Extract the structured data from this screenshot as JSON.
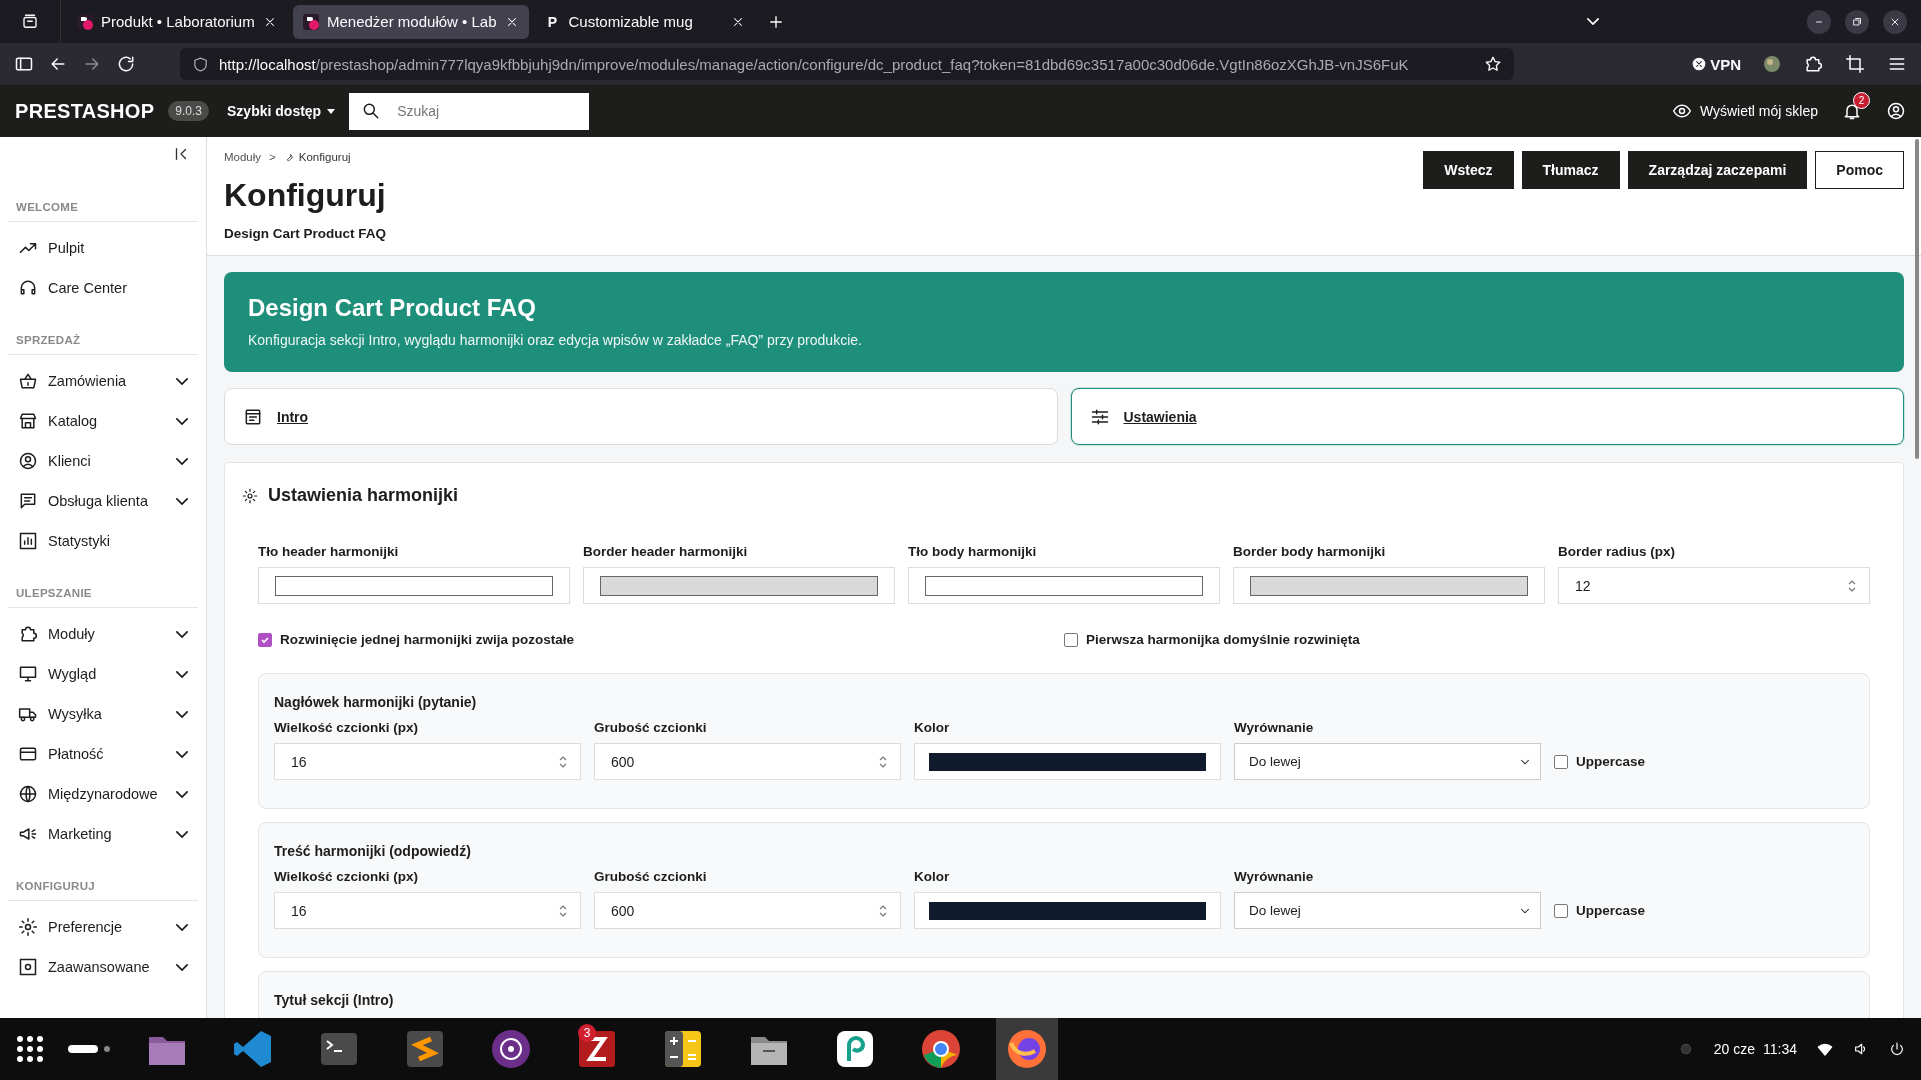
{
  "browser": {
    "tabs": [
      {
        "title": "Produkt • Laboratorium",
        "kind": "ps",
        "selected": false
      },
      {
        "title": "Menedżer modułów • Lab",
        "kind": "ps",
        "selected": true
      },
      {
        "title": "Customizable mug",
        "kind": "letter",
        "letter": "P",
        "selected": false
      }
    ],
    "url_host": "http://localhost",
    "url_path": "/prestashop/admin777lqya9kfbbjuhj9dn/improve/modules/manage/action/configure/dc_product_faq?token=81dbd69c3517a00c30d06de.VgtIn86ozXGhJB-vnJS6FuK",
    "vpn": "VPN"
  },
  "topbar": {
    "brand": "PRESTASHOP",
    "version": "9.0.3",
    "quick_access": "Szybki dostęp",
    "search_placeholder": "Szukaj",
    "view_shop": "Wyświetl mój sklep",
    "notifications": "2"
  },
  "sidebar": {
    "sections": [
      {
        "title": "WELCOME",
        "items": [
          {
            "label": "Pulpit",
            "expandable": false
          },
          {
            "label": "Care Center",
            "expandable": false
          }
        ]
      },
      {
        "title": "SPRZEDAŻ",
        "items": [
          {
            "label": "Zamówienia",
            "expandable": true
          },
          {
            "label": "Katalog",
            "expandable": true
          },
          {
            "label": "Klienci",
            "expandable": true
          },
          {
            "label": "Obsługa klienta",
            "expandable": true
          },
          {
            "label": "Statystyki",
            "expandable": false
          }
        ]
      },
      {
        "title": "ULEPSZANIE",
        "items": [
          {
            "label": "Moduły",
            "expandable": true
          },
          {
            "label": "Wygląd",
            "expandable": true
          },
          {
            "label": "Wysyłka",
            "expandable": true
          },
          {
            "label": "Płatność",
            "expandable": true
          },
          {
            "label": "Międzynarodowe",
            "expandable": true
          },
          {
            "label": "Marketing",
            "expandable": true
          }
        ]
      },
      {
        "title": "KONFIGURUJ",
        "items": [
          {
            "label": "Preferencje",
            "expandable": true
          },
          {
            "label": "Zaawansowane",
            "expandable": true
          }
        ]
      }
    ]
  },
  "page": {
    "breadcrumb": [
      "Moduły",
      "Konfiguruj"
    ],
    "breadcrumb_separator": ">",
    "title": "Konfiguruj",
    "subtitle": "Design Cart Product FAQ",
    "buttons": [
      {
        "label": "Wstecz",
        "kind": "primary"
      },
      {
        "label": "Tłumacz",
        "kind": "primary"
      },
      {
        "label": "Zarządzaj zaczepami",
        "kind": "primary"
      },
      {
        "label": "Pomoc",
        "kind": "outline"
      }
    ]
  },
  "banner": {
    "title": "Design Cart Product FAQ",
    "description": "Konfiguracja sekcji Intro, wyglądu harmonijki oraz edycja wpisów w zakładce „FAQ” przy produkcie."
  },
  "section_tabs": [
    {
      "label": "Intro",
      "selected": false
    },
    {
      "label": "Ustawienia",
      "selected": true
    }
  ],
  "settings": {
    "title": "Ustawienia harmonijki",
    "color_fields": [
      {
        "label": "Tło header harmonijki",
        "color": "#ffffff"
      },
      {
        "label": "Border header harmonijki",
        "color": "#d9d9d9"
      },
      {
        "label": "Tło body harmonijki",
        "color": "#ffffff"
      },
      {
        "label": "Border body harmonijki",
        "color": "#d9d9d9"
      }
    ],
    "radius": {
      "label": "Border radius (px)",
      "value": "12"
    },
    "checkboxes": [
      {
        "label": "Rozwinięcie jednej harmonijki zwija pozostałe",
        "checked": true
      },
      {
        "label": "Pierwsza harmonijka domyślnie rozwinięta",
        "checked": false
      }
    ],
    "groups": [
      {
        "title": "Nagłówek harmonijki (pytanie)",
        "size_label": "Wielkość czcionki (px)",
        "size": "16",
        "weight_label": "Grubość czcionki",
        "weight": "600",
        "color_label": "Kolor",
        "color": "#0f1b2d",
        "align_label": "Wyrównanie",
        "align": "Do lewej",
        "uppercase_label": "Uppercase",
        "uppercase": false
      },
      {
        "title": "Treść harmonijki (odpowiedź)",
        "size_label": "Wielkość czcionki (px)",
        "size": "16",
        "weight_label": "Grubość czcionki",
        "weight": "600",
        "color_label": "Kolor",
        "color": "#0f1b2d",
        "align_label": "Wyrównanie",
        "align": "Do lewej",
        "uppercase_label": "Uppercase",
        "uppercase": false
      },
      {
        "title": "Tytuł sekcji (Intro)"
      }
    ]
  },
  "taskbar": {
    "filezilla_badge": "3",
    "date": "20 cze",
    "time": "11:34"
  }
}
